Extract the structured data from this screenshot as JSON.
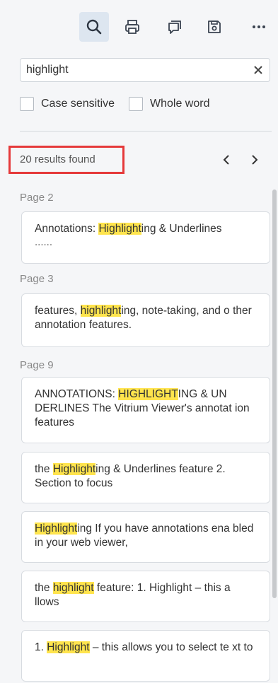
{
  "toolbar": {
    "buttons": [
      {
        "icon": "search-icon",
        "active": true
      },
      {
        "icon": "print-icon",
        "active": false
      },
      {
        "icon": "comment-icon",
        "active": false
      },
      {
        "icon": "save-icon",
        "active": false
      },
      {
        "icon": "more-icon",
        "active": false
      }
    ]
  },
  "search": {
    "value": "highlight",
    "clear_icon": "close-icon",
    "case_sensitive_label": "Case sensitive",
    "whole_word_label": "Whole word",
    "case_sensitive_checked": false,
    "whole_word_checked": false
  },
  "results": {
    "count_label": "20 results found",
    "prev_icon": "chevron-left-icon",
    "next_icon": "chevron-right-icon"
  },
  "pages": [
    "Page 2",
    "Page 3",
    "Page 9"
  ],
  "items": [
    {
      "before": "Annotations: ",
      "match": "Highlight",
      "after": "ing & Underlines",
      "extra": "......"
    },
    {
      "before": "features, ",
      "match": "highlight",
      "after": "ing, note-taking, and o ther annotation features."
    },
    {
      "before": "ANNOTATIONS: ",
      "match": "HIGHLIGHT",
      "after": "ING & UN DERLINES The Vitrium Viewer's annotat ion features"
    },
    {
      "before": "the ",
      "match": "Highlight",
      "after": "ing & Underlines feature 2. Section to focus"
    },
    {
      "before": "",
      "match": "Highlight",
      "after": "ing If you have annotations ena bled in your web viewer,"
    },
    {
      "before": "the ",
      "match": "highlight",
      "after": " feature: 1. Highlight – this a llows"
    },
    {
      "before": "1. ",
      "match": "Highlight",
      "after": " – this allows you to select te xt to"
    }
  ],
  "colors": {
    "highlight": "#ffe44d",
    "annotation_box": "#e5393a",
    "active_tool_bg": "#dde6f0"
  }
}
